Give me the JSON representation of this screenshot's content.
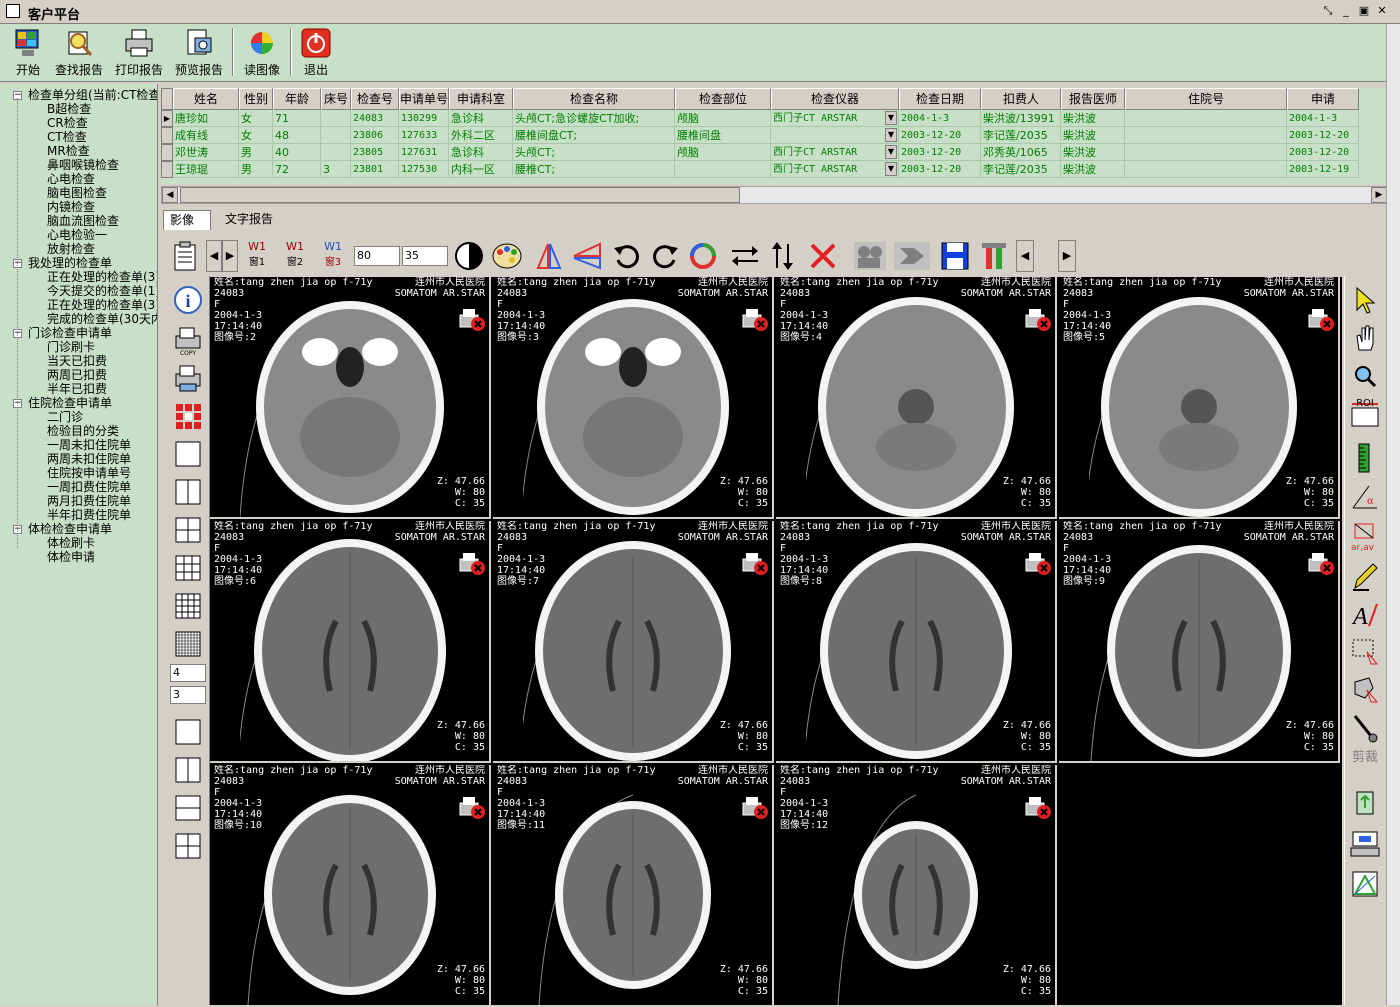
{
  "window": {
    "title": "客户平台"
  },
  "toolbar": {
    "start": "开始",
    "find_report": "查找报告",
    "print_report": "打印报告",
    "preview_report": "预览报告",
    "read_image": "读图像",
    "exit": "退出"
  },
  "tree": {
    "group1": "检查单分组(当前:CT检查)",
    "group1_items": [
      "B超检查",
      "CR检查",
      "CT检查",
      "MR检查",
      "鼻咽喉镜检查",
      "心电检查",
      "脑电图检查",
      "内镜检查",
      "脑血流图检查",
      "心电检验一",
      "放射检查"
    ],
    "group2": "我处理的检查单",
    "group2_items": [
      "正在处理的检查单(3)",
      "今天提交的检查单(1)",
      "正在处理的检查单(3)",
      "完成的检查单(30天内)"
    ],
    "group3": "门诊检查申请单",
    "group3_items": [
      "门诊刷卡",
      "当天已扣费",
      "两周已扣费",
      "半年已扣费"
    ],
    "group4": "住院检查申请单",
    "group4_items": [
      "二门诊",
      "检验目的分类",
      "一周未扣住院单",
      "两周未扣住院单",
      "住院按申请单号",
      "一周扣费住院单",
      "两月扣费住院单",
      "半年扣费住院单"
    ],
    "group5": "体检检查申请单",
    "group5_items": [
      "体检刷卡",
      "体检申请"
    ]
  },
  "grid": {
    "columns": [
      "姓名",
      "性别",
      "年龄",
      "床号",
      "检查号",
      "申请单号",
      "申请科室",
      "检查名称",
      "检查部位",
      "检查仪器",
      "检查日期",
      "扣费人",
      "报告医师",
      "住院号",
      "申请"
    ],
    "rows": [
      [
        "唐珍如",
        "女",
        "71",
        "",
        "24083",
        "130299",
        "急诊科",
        "头颅CT;急诊螺旋CT加收;",
        "颅脑",
        "西门子CT ARSTAR",
        "2004-1-3",
        "柴洪波/13991",
        "柴洪波",
        "",
        "2004-1-3"
      ],
      [
        "成有线",
        "女",
        "48",
        "",
        "23806",
        "127633",
        "外科二区",
        "腰椎间盘CT;",
        "腰椎间盘",
        "",
        "2003-12-20",
        "李记莲/2035",
        "柴洪波",
        "",
        "2003-12-20"
      ],
      [
        "邓世涛",
        "男",
        "40",
        "",
        "23805",
        "127631",
        "急诊科",
        "头颅CT;",
        "颅脑",
        "西门子CT ARSTAR",
        "2003-12-20",
        "邓秀英/1065",
        "柴洪波",
        "",
        "2003-12-20"
      ],
      [
        "王琼琨",
        "男",
        "72",
        "3",
        "23801",
        "127530",
        "内科一区",
        "腰椎CT;",
        "",
        "西门子CT ARSTAR",
        "2003-12-20",
        "李记莲/2035",
        "柴洪波",
        "",
        "2003-12-19"
      ]
    ]
  },
  "tabs": {
    "image": "影像",
    "text_report": "文字报告"
  },
  "image_toolbar": {
    "w1": "W1",
    "w1_sub": "窗1",
    "w2": "W1",
    "w2_sub": "窗2",
    "w3": "W1",
    "w3_sub": "窗3",
    "window_width": "80",
    "window_center": "35"
  },
  "layout_spinners": {
    "cols": "4",
    "rows": "3"
  },
  "right_tools": {
    "roi": "ROI",
    "measure": "ar,av",
    "crop": "剪裁"
  },
  "images": [
    {
      "num": "2",
      "name_line": "姓名:tang zhen jia op f-71y",
      "hospital": "连州市人民医院",
      "scanner": "SOMATOM AR.STAR",
      "id": "24083",
      "sex": "F",
      "date": "2004-1-3",
      "time": "17:14:40",
      "label": "图像号:",
      "z": "Z: 47.66",
      "w": "W: 80",
      "c": "C: 35"
    },
    {
      "num": "3",
      "name_line": "姓名:tang zhen jia op f-71y",
      "hospital": "连州市人民医院",
      "scanner": "SOMATOM AR.STAR",
      "id": "24083",
      "sex": "F",
      "date": "2004-1-3",
      "time": "17:14:40",
      "label": "图像号:",
      "z": "Z: 47.66",
      "w": "W: 80",
      "c": "C: 35"
    },
    {
      "num": "4",
      "name_line": "姓名:tang zhen jia op f-71y",
      "hospital": "连州市人民医院",
      "scanner": "SOMATOM AR.STAR",
      "id": "24083",
      "sex": "F",
      "date": "2004-1-3",
      "time": "17:14:40",
      "label": "图像号:",
      "z": "Z: 47.66",
      "w": "W: 80",
      "c": "C: 35"
    },
    {
      "num": "5",
      "name_line": "姓名:tang zhen jia op f-71y",
      "hospital": "连州市人民医院",
      "scanner": "SOMATOM AR.STAR",
      "id": "24083",
      "sex": "F",
      "date": "2004-1-3",
      "time": "17:14:40",
      "label": "图像号:",
      "z": "Z: 47.66",
      "w": "W: 80",
      "c": "C: 35"
    },
    {
      "num": "6",
      "name_line": "姓名:tang zhen jia op f-71y",
      "hospital": "连州市人民医院",
      "scanner": "SOMATOM AR.STAR",
      "id": "24083",
      "sex": "F",
      "date": "2004-1-3",
      "time": "17:14:40",
      "label": "图像号:",
      "z": "Z: 47.66",
      "w": "W: 80",
      "c": "C: 35"
    },
    {
      "num": "7",
      "name_line": "姓名:tang zhen jia op f-71y",
      "hospital": "连州市人民医院",
      "scanner": "SOMATOM AR.STAR",
      "id": "24083",
      "sex": "F",
      "date": "2004-1-3",
      "time": "17:14:40",
      "label": "图像号:",
      "z": "Z: 47.66",
      "w": "W: 80",
      "c": "C: 35"
    },
    {
      "num": "8",
      "name_line": "姓名:tang zhen jia op f-71y",
      "hospital": "连州市人民医院",
      "scanner": "SOMATOM AR.STAR",
      "id": "24083",
      "sex": "F",
      "date": "2004-1-3",
      "time": "17:14:40",
      "label": "图像号:",
      "z": "Z: 47.66",
      "w": "W: 80",
      "c": "C: 35"
    },
    {
      "num": "9",
      "name_line": "姓名:tang zhen jia op f-71y",
      "hospital": "连州市人民医院",
      "scanner": "SOMATOM AR.STAR",
      "id": "24083",
      "sex": "F",
      "date": "2004-1-3",
      "time": "17:14:40",
      "label": "图像号:",
      "z": "Z: 47.66",
      "w": "W: 80",
      "c": "C: 35"
    },
    {
      "num": "10",
      "name_line": "姓名:tang zhen jia op f-71y",
      "hospital": "连州市人民医院",
      "scanner": "SOMATOM AR.STAR",
      "id": "24083",
      "sex": "F",
      "date": "2004-1-3",
      "time": "17:14:40",
      "label": "图像号:",
      "z": "Z: 47.66",
      "w": "W: 80",
      "c": "C: 35"
    },
    {
      "num": "11",
      "name_line": "姓名:tang zhen jia op f-71y",
      "hospital": "连州市人民医院",
      "scanner": "SOMATOM AR.STAR",
      "id": "24083",
      "sex": "F",
      "date": "2004-1-3",
      "time": "17:14:40",
      "label": "图像号:",
      "z": "Z: 47.66",
      "w": "W: 80",
      "c": "C: 35"
    },
    {
      "num": "12",
      "name_line": "姓名:tang zhen jia op f-71y",
      "hospital": "连州市人民医院",
      "scanner": "SOMATOM AR.STAR",
      "id": "24083",
      "sex": "F",
      "date": "2004-1-3",
      "time": "17:14:40",
      "label": "图像号:",
      "z": "Z: 47.66",
      "w": "W: 80",
      "c": "C: 35"
    }
  ],
  "colors": {
    "panel_green": "#c8e0c8",
    "grid_text": "#008000",
    "face": "#d4d0c8"
  }
}
